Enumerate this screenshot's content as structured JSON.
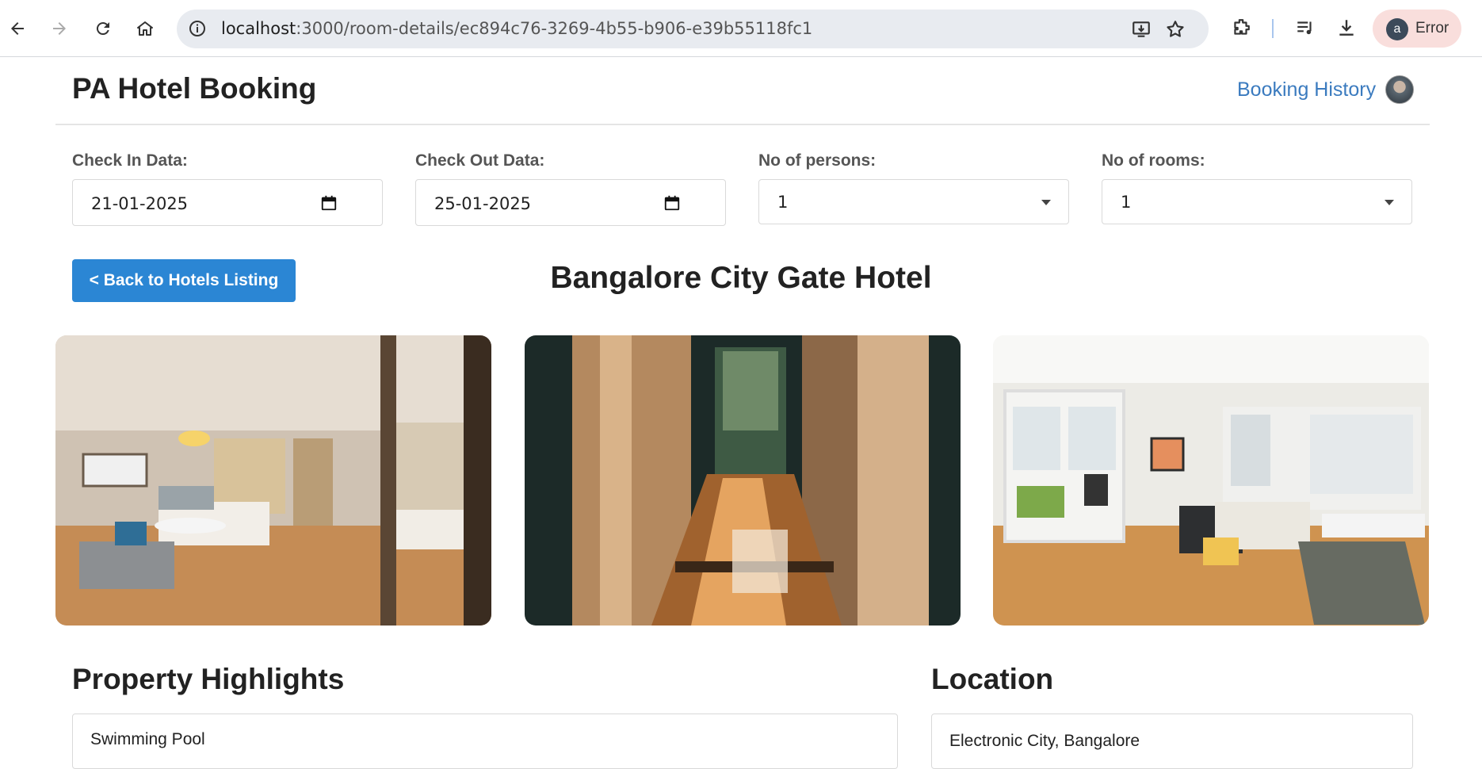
{
  "browser": {
    "url_host": "localhost",
    "url_rest": ":3000/room-details/ec894c76-3269-4b55-b906-e39b55118fc1",
    "profile_initial": "a",
    "profile_status": "Error"
  },
  "header": {
    "title": "PA Hotel Booking",
    "history_link": "Booking History"
  },
  "form": {
    "check_in_label": "Check In Data:",
    "check_in_value": "21-01-2025",
    "check_out_label": "Check Out Data:",
    "check_out_value": "25-01-2025",
    "persons_label": "No of persons:",
    "persons_value": "1",
    "rooms_label": "No of rooms:",
    "rooms_value": "1"
  },
  "hotel": {
    "back_label": "< Back to Hotels Listing",
    "name": "Bangalore City Gate Hotel"
  },
  "highlights": {
    "title": "Property Highlights",
    "items": [
      "Swimming Pool"
    ]
  },
  "location": {
    "title": "Location",
    "value": "Electronic City, Bangalore"
  }
}
